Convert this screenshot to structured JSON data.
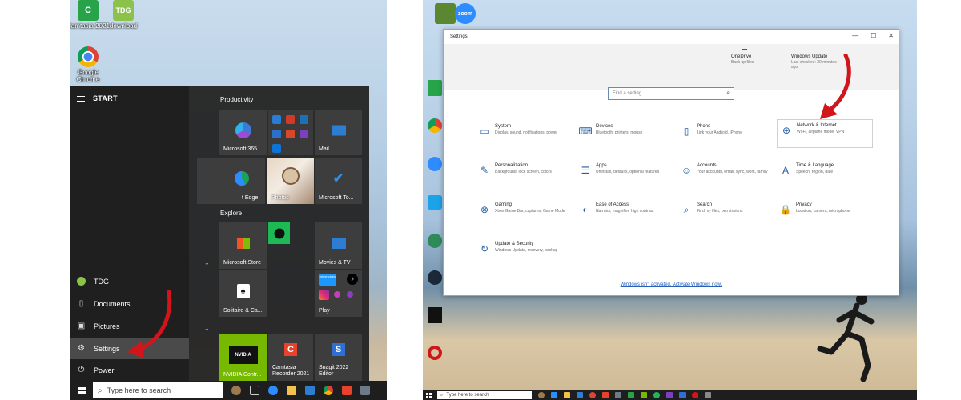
{
  "left": {
    "desktop_icons": [
      {
        "name": "camtasia-desktop-icon",
        "label": "Camtasia 2021",
        "color": "#27a34a",
        "glyph": "C"
      },
      {
        "name": "tdg-desktop-icon",
        "label": "download",
        "color": "#8bc34a",
        "glyph": "TDG"
      },
      {
        "name": "chrome-desktop-icon",
        "label": "Google Chrome",
        "color": "#db4437",
        "glyph": "●"
      }
    ],
    "start": {
      "header": "START",
      "rail": {
        "user": "TDG",
        "documents": "Documents",
        "pictures": "Pictures",
        "settings": "Settings",
        "power": "Power"
      },
      "groups": {
        "productivity": "Productivity",
        "explore": "Explore"
      },
      "tiles": {
        "m365": "Microsoft 365...",
        "mail": "Mail",
        "edge": "t Edge",
        "photos": "Photos",
        "todo": "Microsoft To...",
        "store": "Microsoft Store",
        "movies": "Movies & TV",
        "solitaire": "Solitaire & Ca...",
        "play": "Play",
        "play_prime": "prime video",
        "nvidia": "NVIDIA Contr...",
        "nvidia_logo": "NVIDIA",
        "camtasia": "Camtasia Recorder 2021",
        "snagit": "Snagit 2022 Editor"
      }
    },
    "taskbar": {
      "search_placeholder": "Type here to search"
    }
  },
  "right": {
    "desktop_icons": [
      {
        "name": "minecraft-desktop-icon",
        "label": "",
        "color": "#5b8731"
      },
      {
        "name": "zoom-desktop-icon",
        "label": "Zoom",
        "color": "#2d8cff",
        "glyph": "zoom"
      }
    ],
    "settings": {
      "title": "Settings",
      "controls": [
        "—",
        "☐",
        "✕"
      ],
      "top": {
        "onedrive": {
          "title": "OneDrive",
          "sub": "Back up files"
        },
        "update": {
          "title": "Windows Update",
          "sub": "Last checked: 20 minutes ago"
        }
      },
      "search_placeholder": "Find a setting",
      "categories": [
        {
          "id": "system",
          "name": "System",
          "desc": "Display, sound, notifications, power",
          "icon": "▭"
        },
        {
          "id": "devices",
          "name": "Devices",
          "desc": "Bluetooth, printers, mouse",
          "icon": "⌨"
        },
        {
          "id": "phone",
          "name": "Phone",
          "desc": "Link your Android, iPhone",
          "icon": "▯"
        },
        {
          "id": "network",
          "name": "Network & Internet",
          "desc": "Wi-Fi, airplane mode, VPN",
          "icon": "⊕"
        },
        {
          "id": "personalization",
          "name": "Personalization",
          "desc": "Background, lock screen, colors",
          "icon": "✎"
        },
        {
          "id": "apps",
          "name": "Apps",
          "desc": "Uninstall, defaults, optional features",
          "icon": "☰"
        },
        {
          "id": "accounts",
          "name": "Accounts",
          "desc": "Your accounts, email, sync, work, family",
          "icon": "☺"
        },
        {
          "id": "time",
          "name": "Time & Language",
          "desc": "Speech, region, date",
          "icon": "A"
        },
        {
          "id": "gaming",
          "name": "Gaming",
          "desc": "Xbox Game Bar, captures, Game Mode",
          "icon": "⊗"
        },
        {
          "id": "ease",
          "name": "Ease of Access",
          "desc": "Narrator, magnifier, high contrast",
          "icon": "◐"
        },
        {
          "id": "search",
          "name": "Search",
          "desc": "Find my files, permissions",
          "icon": "⌕"
        },
        {
          "id": "privacy",
          "name": "Privacy",
          "desc": "Location, camera, microphone",
          "icon": "🔒"
        },
        {
          "id": "update",
          "name": "Update & Security",
          "desc": "Windows Update, recovery, backup",
          "icon": "↻"
        }
      ],
      "activate_link": "Windows isn't activated. Activate Windows now."
    },
    "taskbar": {
      "search_placeholder": "Type here to search"
    }
  },
  "colors": {
    "accent_blue": "#1f5ea8",
    "arrow_red": "#d0161b",
    "start_bg": "#242424"
  }
}
